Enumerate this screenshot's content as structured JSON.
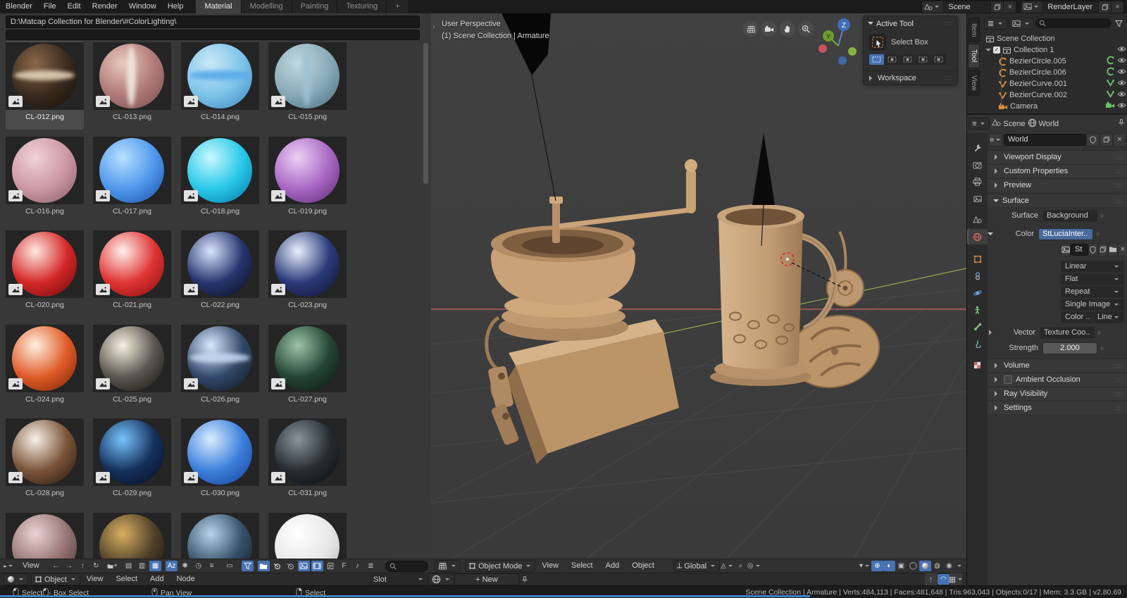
{
  "topbar": {
    "menus": [
      "Blender",
      "File",
      "Edit",
      "Render",
      "Window",
      "Help"
    ],
    "tabs": [
      {
        "label": "Material",
        "active": true
      },
      {
        "label": "Modelling",
        "active": false
      },
      {
        "label": "Painting",
        "active": false
      },
      {
        "label": "Texturing",
        "active": false
      },
      {
        "label": "+",
        "active": false
      }
    ],
    "scene_label": "Scene",
    "render_layer_label": "RenderLayer"
  },
  "filebrowser": {
    "path": "D:\\Matcap Collection for Blender\\#ColorLighting\\",
    "view_menu": "View",
    "sort_alpha": "Az",
    "font_filter": "F",
    "items": [
      {
        "name": "CL-012.png",
        "selected": true,
        "c1": "#8a6848",
        "c2": "#3a2a1e",
        "c3": "#141009",
        "band": "h",
        "bandColor": "#ead9bf"
      },
      {
        "name": "CL-013.png",
        "selected": false,
        "c1": "#e9cabe",
        "c2": "#b07a78",
        "c3": "#7a5050",
        "band": "v",
        "bandColor": "#f2ece2"
      },
      {
        "name": "CL-014.png",
        "selected": false,
        "c1": "#cbe9f8",
        "c2": "#7ec4ea",
        "c3": "#3f87c0",
        "band": "h",
        "bandColor": "#55a8e8"
      },
      {
        "name": "CL-015.png",
        "selected": false,
        "c1": "#c2d9e1",
        "c2": "#88aab8",
        "c3": "#4a7080",
        "band": "v",
        "bandColor": "#9fc2d2"
      },
      {
        "name": "CL-016.png",
        "selected": false,
        "c1": "#f2d2da",
        "c2": "#cc98a4",
        "c3": "#8a5f66",
        "band": "",
        "bandColor": ""
      },
      {
        "name": "CL-017.png",
        "selected": false,
        "c1": "#b9e1ff",
        "c2": "#5098ec",
        "c3": "#1c50a8",
        "band": "",
        "bandColor": ""
      },
      {
        "name": "CL-018.png",
        "selected": false,
        "c1": "#c9f9ff",
        "c2": "#28c8e8",
        "c3": "#0878a8",
        "band": "",
        "bandColor": ""
      },
      {
        "name": "CL-019.png",
        "selected": false,
        "c1": "#edd1f5",
        "c2": "#a868c4",
        "c3": "#5c2c74",
        "band": "",
        "bandColor": ""
      },
      {
        "name": "CL-020.png",
        "selected": false,
        "c1": "#ffe9e1",
        "c2": "#d42828",
        "c3": "#6e0a0a",
        "band": "",
        "bandColor": ""
      },
      {
        "name": "CL-021.png",
        "selected": false,
        "c1": "#fff1ed",
        "c2": "#e03434",
        "c3": "#8a0f0f",
        "band": "",
        "bandColor": ""
      },
      {
        "name": "CL-022.png",
        "selected": false,
        "c1": "#d9e5ff",
        "c2": "#26356e",
        "c3": "#0a0e20",
        "band": "",
        "bandColor": ""
      },
      {
        "name": "CL-023.png",
        "selected": false,
        "c1": "#e9f1ff",
        "c2": "#2a3a78",
        "c3": "#0e1430",
        "band": "",
        "bandColor": ""
      },
      {
        "name": "CL-024.png",
        "selected": false,
        "c1": "#fff1e1",
        "c2": "#e05c28",
        "c3": "#7a2408",
        "band": "",
        "bandColor": ""
      },
      {
        "name": "CL-025.png",
        "selected": false,
        "c1": "#f9f1e1",
        "c2": "#5a5650",
        "c3": "#171513",
        "band": "",
        "bandColor": ""
      },
      {
        "name": "CL-026.png",
        "selected": false,
        "c1": "#d9e9ff",
        "c2": "#32486a",
        "c3": "#0e1620",
        "band": "h",
        "bandColor": "#c8daf4"
      },
      {
        "name": "CL-027.png",
        "selected": false,
        "c1": "#9cc4a8",
        "c2": "#234434",
        "c3": "#0a1810",
        "band": "",
        "bandColor": ""
      },
      {
        "name": "CL-028.png",
        "selected": false,
        "c1": "#f9f1e9",
        "c2": "#7a5438",
        "c3": "#28180e",
        "band": "",
        "bandColor": ""
      },
      {
        "name": "CL-029.png",
        "selected": false,
        "c1": "#78c4ff",
        "c2": "#14305c",
        "c3": "#060e20",
        "band": "",
        "bandColor": ""
      },
      {
        "name": "CL-030.png",
        "selected": false,
        "c1": "#d9edff",
        "c2": "#3c80dc",
        "c3": "#16409c",
        "band": "",
        "bandColor": ""
      },
      {
        "name": "CL-031.png",
        "selected": false,
        "c1": "#8a949c",
        "c2": "#262c32",
        "c3": "#0b0e12",
        "band": "",
        "bandColor": ""
      },
      {
        "name": "",
        "selected": false,
        "c1": "#ecd4d4",
        "c2": "#967474",
        "c3": "#4a3434",
        "band": "",
        "bandColor": ""
      },
      {
        "name": "",
        "selected": false,
        "c1": "#d8b060",
        "c2": "#50402a",
        "c3": "#181208",
        "band": "",
        "bandColor": ""
      },
      {
        "name": "",
        "selected": false,
        "c1": "#b8d4ec",
        "c2": "#36506a",
        "c3": "#101a24",
        "band": "",
        "bandColor": ""
      },
      {
        "name": "",
        "selected": false,
        "c1": "#ffffff",
        "c2": "#e8e8e8",
        "c3": "#b8b8b8",
        "band": "",
        "bandColor": ""
      }
    ]
  },
  "viewport": {
    "perspective_label": "User Perspective",
    "collection_label": "(1) Scene Collection | Armature",
    "sidebar_tabs": [
      {
        "label": "Item",
        "active": false
      },
      {
        "label": "Tool",
        "active": true
      },
      {
        "label": "View",
        "active": false
      }
    ],
    "active_tool": {
      "title": "Active Tool",
      "tool_name": "Select Box",
      "workspace_title": "Workspace"
    },
    "header": {
      "mode": "Object Mode",
      "menus": [
        "View",
        "Select",
        "Add",
        "Object"
      ],
      "orientation": "Global"
    },
    "gizmo": {
      "z_label": "Z",
      "y_label": "Y"
    }
  },
  "outliner": {
    "root_label": "Scene Collection",
    "collection_label": "Collection 1",
    "children": [
      {
        "label": "BezierCircle.005",
        "type": "curve-circle"
      },
      {
        "label": "BezierCircle.006",
        "type": "curve-circle"
      },
      {
        "label": "BezierCurve.001",
        "type": "curve"
      },
      {
        "label": "BezierCurve.002",
        "type": "curve"
      },
      {
        "label": "Camera",
        "type": "camera"
      }
    ]
  },
  "properties": {
    "breadcrumb_scene": "Scene",
    "breadcrumb_world": "World",
    "world_name": "World",
    "tab_icons": [
      "tool",
      "render",
      "output",
      "view-layer",
      "scene",
      "world",
      "object",
      "constraints",
      "physics",
      "object-data",
      "bone",
      "data",
      "texture"
    ],
    "active_tab": "world",
    "panels_top": [
      "Viewport Display",
      "Custom Properties",
      "Preview"
    ],
    "surface_title": "Surface",
    "rows": {
      "surface_label": "Surface",
      "surface_value": "Background",
      "color_label": "Color",
      "color_value": "StLuciaInter..",
      "image_short": "St",
      "vector_label": "Vector",
      "vector_value": "Texture Coo..",
      "strength_label": "Strength",
      "strength_value": "2.000"
    },
    "dropdowns": [
      "Linear",
      "Flat",
      "Repeat",
      "Single Image"
    ],
    "split_dropdown": [
      "Color ..",
      "Line"
    ],
    "panels_bottom": [
      {
        "label": "Volume",
        "checkbox": false
      },
      {
        "label": "Ambient Occlusion",
        "checkbox": true
      },
      {
        "label": "Ray Visibility",
        "checkbox": false
      },
      {
        "label": "Settings",
        "checkbox": false
      }
    ]
  },
  "shader": {
    "object_label": "Object",
    "menus": [
      "View",
      "Select",
      "Add",
      "Node"
    ],
    "slot_label": "Slot",
    "new_label": "New"
  },
  "statusbar": {
    "hints": [
      {
        "label": "Select",
        "btn": "lmb"
      },
      {
        "label": "Box Select",
        "btn": "lmb-drag"
      },
      {
        "label": "Pan View",
        "btn": "mmb"
      },
      {
        "label": "Select",
        "btn": "rmb"
      }
    ],
    "stats": "Scene Collection | Armature | Verts:484,113 | Faces:481,648 | Tris:963,043 | Objects:0/17 | Mem: 3.3 GB | v2.80.69"
  },
  "colors": {
    "accent": "#4772b3",
    "axis_x": "#b85f5f",
    "axis_y": "#95a84f",
    "object_tan": "#c7a47e",
    "cursor_red": "#cc3b3b"
  }
}
